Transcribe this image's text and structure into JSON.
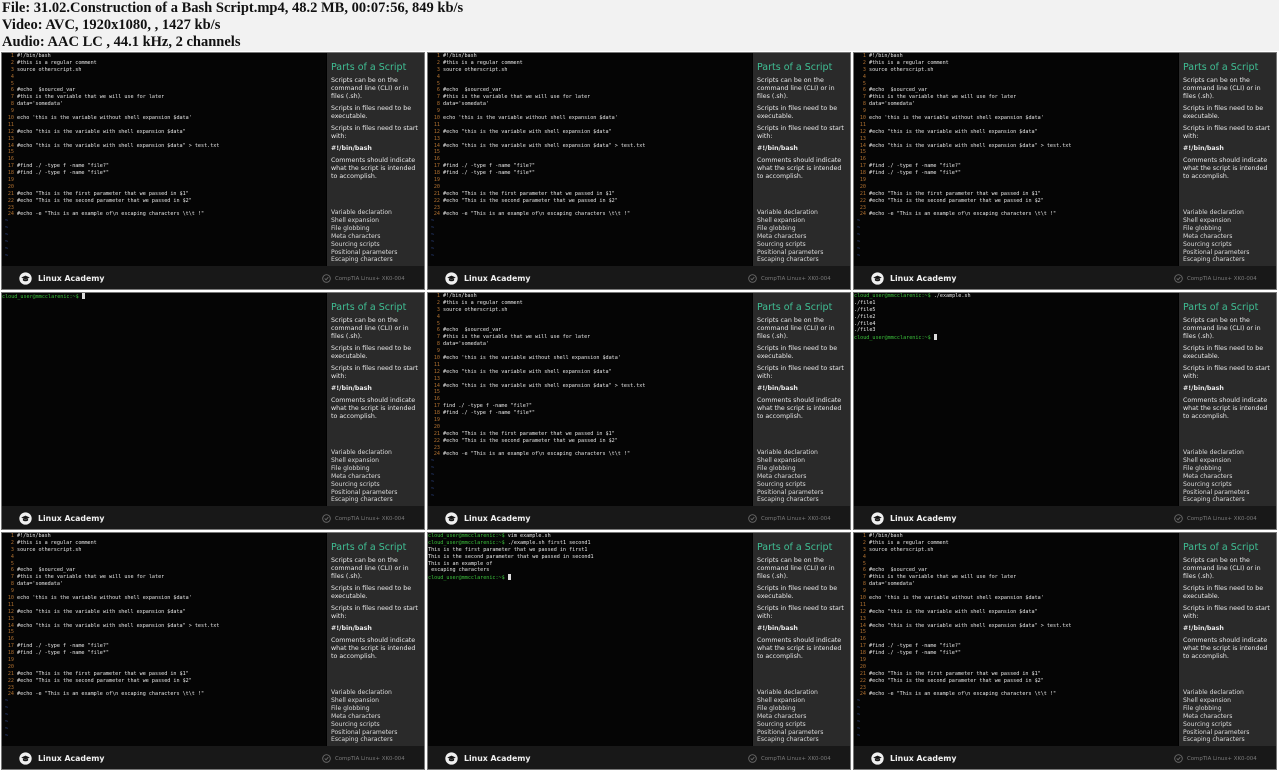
{
  "header": {
    "file": "File: 31.02.Construction of a Bash Script.mp4, 48.2 MB, 00:07:56, 849 kb/s",
    "video": "Video: AVC, 1920x1080, , 1427 kb/s",
    "audio": "Audio: AAC LC , 44.1 kHz, 2 channels"
  },
  "panel": {
    "title": "Parts of a Script",
    "paragraphs": [
      "Scripts can be on the command line (CLI) or in files (.sh).",
      "Scripts in files need to be executable.",
      "Scripts in files need to start with:",
      "#!/bin/bash",
      "Comments should indicate what the script is intended to accomplish."
    ],
    "topics": [
      "Variable declaration",
      "Shell expansion",
      "File globbing",
      "Meta characters",
      "Sourcing scripts",
      "Positional parameters",
      "Escaping characters"
    ]
  },
  "footer": {
    "brand": "Linux Academy",
    "course": "CompTIA Linux+ XK0-004"
  },
  "prompt": "cloud_user@mmcclarenic:~$",
  "frames": [
    {
      "kind": "editor",
      "variant": "a"
    },
    {
      "kind": "editor",
      "variant": "a"
    },
    {
      "kind": "editor",
      "variant": "a"
    },
    {
      "kind": "shell",
      "lines": [
        {
          "p": true,
          "t": ""
        }
      ]
    },
    {
      "kind": "editor",
      "variant": "b"
    },
    {
      "kind": "shell",
      "lines": [
        {
          "p": true,
          "t": " ./example.sh"
        },
        {
          "p": false,
          "t": "./file1"
        },
        {
          "p": false,
          "t": "./file5"
        },
        {
          "p": false,
          "t": "./file2"
        },
        {
          "p": false,
          "t": "./file4"
        },
        {
          "p": false,
          "t": "./file3"
        },
        {
          "p": true,
          "t": ""
        }
      ]
    },
    {
      "kind": "editor",
      "variant": "a"
    },
    {
      "kind": "shell",
      "lines": [
        {
          "p": true,
          "t": " vim example.sh"
        },
        {
          "p": true,
          "t": " ./example.sh first1 second1"
        },
        {
          "p": false,
          "t": "This is the first parameter that we passed in first1"
        },
        {
          "p": false,
          "t": "This is the second parameter that we passed in second1"
        },
        {
          "p": false,
          "t": "This is an example of"
        },
        {
          "p": false,
          "t": " escaping characters"
        },
        {
          "p": true,
          "t": ""
        }
      ]
    },
    {
      "kind": "editor",
      "variant": "a"
    }
  ],
  "editor": {
    "a": [
      "#!/bin/bash",
      "#this is a regular comment",
      "source otherscript.sh",
      "",
      "",
      "#echo  $sourced_var",
      "#this is the variable that we will use for later",
      "data='somedata'",
      "",
      "echo 'this is the variable without shell expansion $data'",
      "",
      "#echo \"this is the variable with shell expansion $data\"",
      "",
      "#echo \"this is the variable with shell expansion $data\" > test.txt",
      "",
      "",
      "#find ./ -type f -name \"file?\"",
      "#find ./ -type f -name \"file*\"",
      "",
      "",
      "#echo \"This is the first parameter that we passed in $1\"",
      "#echo \"This is the second parameter that we passed in $2\"",
      "",
      "#echo -e \"This is an example of\\n escaping characters \\t\\t !\""
    ],
    "b": [
      "#!/bin/bash",
      "#this is a regular comment",
      "source otherscript.sh",
      "",
      "",
      "#echo  $sourced_var",
      "#this is the variable that we will use for later",
      "data='somedata'",
      "",
      "#echo 'this is the variable without shell expansion $data'",
      "",
      "#echo \"this is the variable with shell expansion $data\"",
      "",
      "#echo \"this is the variable with shell expansion $data\" > test.txt",
      "",
      "",
      "find ./ -type f -name \"file?\"",
      "#find ./ -type f -name \"file*\"",
      "",
      "",
      "#echo \"This is the first parameter that we passed in $1\"",
      "#echo \"This is the second parameter that we passed in $2\"",
      "",
      "#echo -e \"This is an example of\\n escaping characters \\t\\t !\""
    ]
  }
}
